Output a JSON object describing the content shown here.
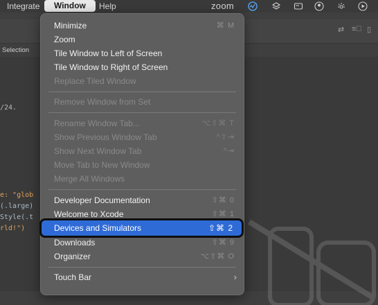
{
  "menubar": {
    "items": [
      "Integrate",
      "Window",
      "Help"
    ],
    "zoom_label": "zoom"
  },
  "editor": {
    "tab_label": "Selection",
    "code_lines": [
      "/24.",
      "e: \"glob",
      "(.large)",
      "Style(.t",
      "rld!\")"
    ]
  },
  "window_menu": {
    "items": [
      {
        "label": "Minimize",
        "shortcut": "⌘ M",
        "enabled": true
      },
      {
        "label": "Zoom",
        "shortcut": "",
        "enabled": true
      },
      {
        "label": "Tile Window to Left of Screen",
        "shortcut": "",
        "enabled": true
      },
      {
        "label": "Tile Window to Right of Screen",
        "shortcut": "",
        "enabled": true
      },
      {
        "label": "Replace Tiled Window",
        "shortcut": "",
        "enabled": false
      },
      {
        "label": "Remove Window from Set",
        "shortcut": "",
        "enabled": false
      },
      {
        "label": "Rename Window Tab...",
        "shortcut": "⌥⇧⌘ T",
        "enabled": false
      },
      {
        "label": "Show Previous Window Tab",
        "shortcut": "^⇧⇥",
        "enabled": false
      },
      {
        "label": "Show Next Window Tab",
        "shortcut": "^⇥",
        "enabled": false
      },
      {
        "label": "Move Tab to New Window",
        "shortcut": "",
        "enabled": false
      },
      {
        "label": "Merge All Windows",
        "shortcut": "",
        "enabled": false
      },
      {
        "label": "Developer Documentation",
        "shortcut": "⇧⌘ 0",
        "enabled": true
      },
      {
        "label": "Welcome to Xcode",
        "shortcut": "⇧⌘ 1",
        "enabled": true
      },
      {
        "label": "Devices and Simulators",
        "shortcut": "⇧⌘ 2",
        "enabled": true,
        "highlighted": true
      },
      {
        "label": "Downloads",
        "shortcut": "⇧⌘ 9",
        "enabled": true
      },
      {
        "label": "Organizer",
        "shortcut": "⌥⇧⌘ O",
        "enabled": true
      },
      {
        "label": "Touch Bar",
        "shortcut": "",
        "enabled": true
      }
    ]
  },
  "colors": {
    "highlight": "#2f6bd6",
    "menu_bg": "#5e5e5e"
  }
}
